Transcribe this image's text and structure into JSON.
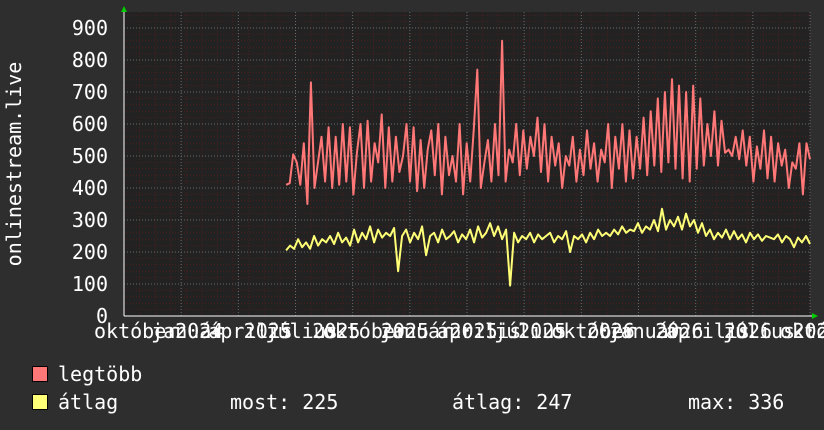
{
  "chart_data": {
    "type": "line",
    "ylabel": "onlinestream.live",
    "ylim": [
      0,
      950
    ],
    "yticks": [
      0,
      100,
      200,
      300,
      400,
      500,
      600,
      700,
      800,
      900
    ],
    "x_tick_labels": [
      "október",
      "január",
      "április",
      "július",
      "október",
      "január",
      "április",
      "július",
      "október",
      "január",
      "április",
      "július",
      "október"
    ],
    "x_tick_year_labels": [
      "2024",
      "2025",
      "2025",
      "2025",
      "2025",
      "2025",
      "2026",
      "2026",
      "2026",
      "202"
    ],
    "xlim": [
      0,
      22
    ],
    "x_data_start": 5.2,
    "series": [
      {
        "name": "legtöbb",
        "color": "#ff7777",
        "values": [
          410,
          415,
          505,
          480,
          410,
          540,
          350,
          730,
          400,
          480,
          560,
          420,
          590,
          400,
          560,
          410,
          600,
          420,
          590,
          380,
          510,
          600,
          400,
          610,
          420,
          540,
          480,
          630,
          400,
          590,
          420,
          560,
          450,
          500,
          600,
          420,
          590,
          390,
          550,
          400,
          520,
          580,
          440,
          600,
          380,
          560,
          440,
          500,
          420,
          600,
          380,
          540,
          420,
          580,
          770,
          400,
          480,
          550,
          420,
          600,
          440,
          860,
          420,
          520,
          480,
          600,
          440,
          580,
          460,
          560,
          500,
          620,
          450,
          600,
          420,
          560,
          470,
          540,
          400,
          500,
          470,
          560,
          420,
          520,
          440,
          580,
          460,
          540,
          420,
          520,
          480,
          600,
          400,
          560,
          460,
          600,
          420,
          580,
          430,
          560,
          460,
          620,
          440,
          640,
          470,
          680,
          450,
          700,
          480,
          740,
          460,
          720,
          430,
          700,
          420,
          720,
          460,
          680,
          470,
          600,
          500,
          640,
          470,
          610,
          510,
          520,
          500,
          560,
          490,
          580,
          470,
          560,
          420,
          530,
          460,
          580,
          430,
          560,
          420,
          540,
          470,
          520,
          400,
          480,
          460,
          540,
          380,
          540,
          490
        ]
      },
      {
        "name": "átlag",
        "color": "#ffff77",
        "values": [
          205,
          220,
          210,
          240,
          215,
          230,
          210,
          250,
          220,
          240,
          230,
          250,
          225,
          260,
          230,
          245,
          220,
          270,
          230,
          260,
          240,
          280,
          230,
          270,
          245,
          260,
          250,
          275,
          140,
          250,
          270,
          230,
          260,
          240,
          280,
          190,
          250,
          260,
          230,
          270,
          240,
          250,
          265,
          230,
          255,
          240,
          270,
          230,
          280,
          245,
          260,
          290,
          250,
          280,
          240,
          270,
          95,
          260,
          230,
          250,
          240,
          260,
          230,
          255,
          240,
          250,
          260,
          230,
          250,
          240,
          265,
          200,
          250,
          240,
          255,
          230,
          260,
          240,
          270,
          250,
          260,
          250,
          270,
          255,
          280,
          260,
          270,
          265,
          290,
          260,
          280,
          270,
          300,
          265,
          335,
          270,
          300,
          280,
          310,
          270,
          320,
          280,
          300,
          260,
          290,
          250,
          270,
          240,
          260,
          245,
          270,
          240,
          265,
          240,
          255,
          230,
          260,
          240,
          255,
          235,
          250,
          245,
          240,
          255,
          230,
          250,
          240,
          215,
          245,
          230,
          250,
          225
        ]
      }
    ],
    "legend_position": "bottom-left",
    "grid": true
  },
  "legend": {
    "max_series": "legtöbb",
    "avg_series": "átlag",
    "now_text": "most: 225",
    "avg_text": "átlag: 247",
    "max_text": "max: 336"
  },
  "colors": {
    "background": "#2e2e2e",
    "plot_bg": "#222222",
    "grid_minor": "#4a1f1f",
    "grid_major": "#6a6a6a",
    "axis": "#ffffff",
    "arrow": "#00cc00"
  }
}
